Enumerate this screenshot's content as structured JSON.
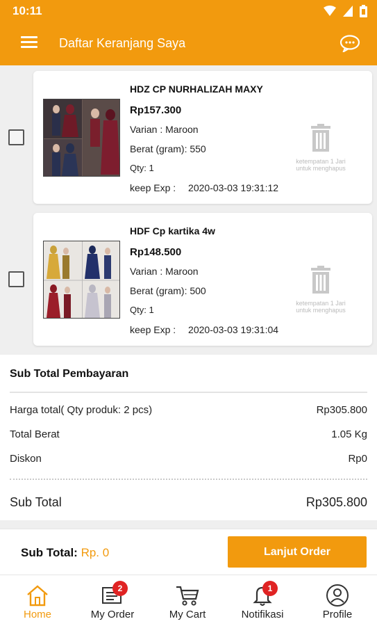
{
  "status_bar": {
    "time": "10:11"
  },
  "app_bar": {
    "title": "Daftar Keranjang Saya",
    "menu_icon": "hamburger-icon",
    "chat_icon": "chat-bubble-icon"
  },
  "cart_items": [
    {
      "name": "HDZ CP NURHALIZAH MAXY",
      "price": "Rp157.300",
      "variant": "Varian : Maroon",
      "weight": "Berat (gram): 550",
      "qty": "Qty: 1",
      "keep_label": "keep Exp :",
      "keep_value": "2020-03-03 19:31:12",
      "delete_hint": "ketempatan 1 Jari untuk menghapus"
    },
    {
      "name": "HDF Cp kartika 4w",
      "price": "Rp148.500",
      "variant": "Varian : Maroon",
      "weight": "Berat (gram): 500",
      "qty": "Qty: 1",
      "keep_label": "keep Exp :",
      "keep_value": "2020-03-03 19:31:04",
      "delete_hint": "ketempatan 1 Jari untuk menghapus"
    }
  ],
  "summary": {
    "title": "Sub Total Pembayaran",
    "rows": [
      {
        "label": "Harga total( Qty produk: 2 pcs)",
        "value": "Rp305.800"
      },
      {
        "label": "Total Berat",
        "value": "1.05 Kg"
      },
      {
        "label": "Diskon",
        "value": "Rp0"
      }
    ],
    "subtotal_label": "Sub Total",
    "subtotal_value": "Rp305.800"
  },
  "footer": {
    "label": "Sub Total:",
    "amount": "Rp. 0",
    "button": "Lanjut Order"
  },
  "bottom_nav": [
    {
      "label": "Home",
      "icon": "home-icon",
      "active": true
    },
    {
      "label": "My Order",
      "icon": "order-icon",
      "badge": "2"
    },
    {
      "label": "My Cart",
      "icon": "cart-icon"
    },
    {
      "label": "Notifikasi",
      "icon": "bell-icon",
      "badge": "1"
    },
    {
      "label": "Profile",
      "icon": "profile-icon"
    }
  ],
  "colors": {
    "accent": "#f29a0e",
    "badge": "#e02323"
  }
}
